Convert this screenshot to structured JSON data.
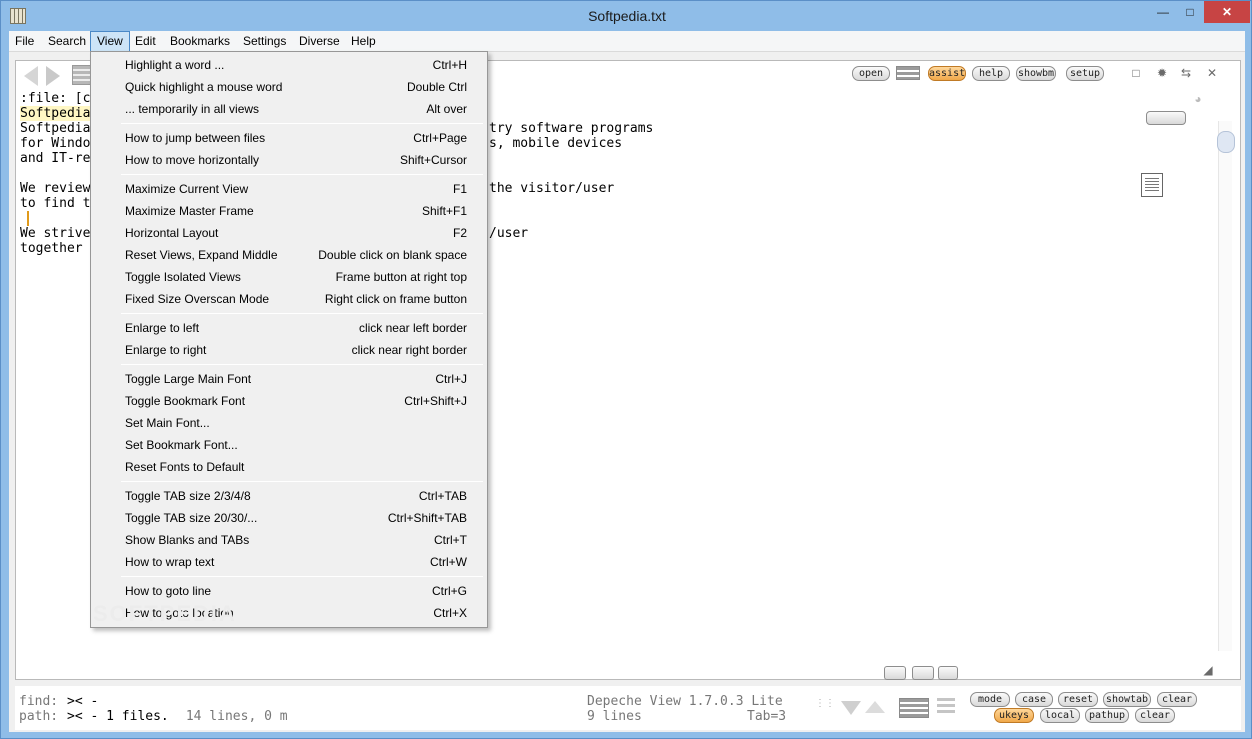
{
  "window": {
    "title": "Softpedia.txt"
  },
  "menubar": [
    "File",
    "Search",
    "View",
    "Edit",
    "Bookmarks",
    "Settings",
    "Diverse",
    "Help"
  ],
  "toolbar": {
    "open": "open",
    "assist": "assist",
    "help": "help",
    "showbm": "showbm",
    "setup": "setup"
  },
  "editor": {
    "lines": [
      ":file: [c",
      "Softpedia",
      "Softpedia",
      "for Windo",
      "and IT-re",
      "",
      "We review",
      "to find t",
      "",
      "We strive",
      "together"
    ],
    "right_lines": [
      "try software programs",
      "s, mobile devices",
      "",
      "",
      "the visitor/user",
      "",
      "",
      "",
      "/user"
    ]
  },
  "view_menu": {
    "groups": [
      [
        {
          "label": "Highlight a word ...",
          "shortcut": "Ctrl+H"
        },
        {
          "label": "Quick highlight a mouse word",
          "shortcut": "Double Ctrl"
        },
        {
          "label": "... temporarily in all views",
          "shortcut": "Alt over"
        }
      ],
      [
        {
          "label": "How to jump between files",
          "shortcut": "Ctrl+Page"
        },
        {
          "label": "How to move horizontally",
          "shortcut": "Shift+Cursor"
        }
      ],
      [
        {
          "label": "Maximize Current View",
          "shortcut": "F1"
        },
        {
          "label": "Maximize Master Frame",
          "shortcut": "Shift+F1"
        },
        {
          "label": "Horizontal Layout",
          "shortcut": "F2"
        },
        {
          "label": "Reset Views, Expand Middle",
          "shortcut": "Double click on blank space"
        },
        {
          "label": "Toggle Isolated Views",
          "shortcut": "Frame button at right top"
        },
        {
          "label": "Fixed Size Overscan Mode",
          "shortcut": "Right click on frame button"
        }
      ],
      [
        {
          "label": "Enlarge to left",
          "shortcut": "click near left border"
        },
        {
          "label": "Enlarge to right",
          "shortcut": "click near right border"
        }
      ],
      [
        {
          "label": "Toggle Large Main Font",
          "shortcut": "Ctrl+J"
        },
        {
          "label": "Toggle Bookmark Font",
          "shortcut": "Ctrl+Shift+J"
        },
        {
          "label": "Set Main Font...",
          "shortcut": ""
        },
        {
          "label": "Set Bookmark Font...",
          "shortcut": ""
        },
        {
          "label": "Reset Fonts to Default",
          "shortcut": ""
        }
      ],
      [
        {
          "label": "Toggle TAB size 2/3/4/8",
          "shortcut": "Ctrl+TAB"
        },
        {
          "label": "Toggle TAB size 20/30/...",
          "shortcut": "Ctrl+Shift+TAB"
        },
        {
          "label": "Show Blanks and TABs",
          "shortcut": "Ctrl+T"
        },
        {
          "label": "How to wrap text",
          "shortcut": "Ctrl+W"
        }
      ],
      [
        {
          "label": "How to goto line",
          "shortcut": "Ctrl+G"
        },
        {
          "label": "How to goto location",
          "shortcut": "Ctrl+X"
        }
      ]
    ]
  },
  "status": {
    "find_label": "find:",
    "find_value": ">< -",
    "path_label": "path:",
    "path_value": ">< - 1 files.",
    "path_extra": " 14 lines, 0 m",
    "version": "Depeche View 1.7.0.3 Lite",
    "lines": "9 lines",
    "tab": "Tab=3"
  },
  "bottom_buttons": {
    "mode": "mode",
    "case": "case",
    "reset": "reset",
    "showtab": "showtab",
    "clear1": "clear",
    "ukeys": "ukeys",
    "local": "local",
    "pathup": "pathup",
    "clear2": "clear"
  },
  "watermark": "SOFTPEDIA"
}
